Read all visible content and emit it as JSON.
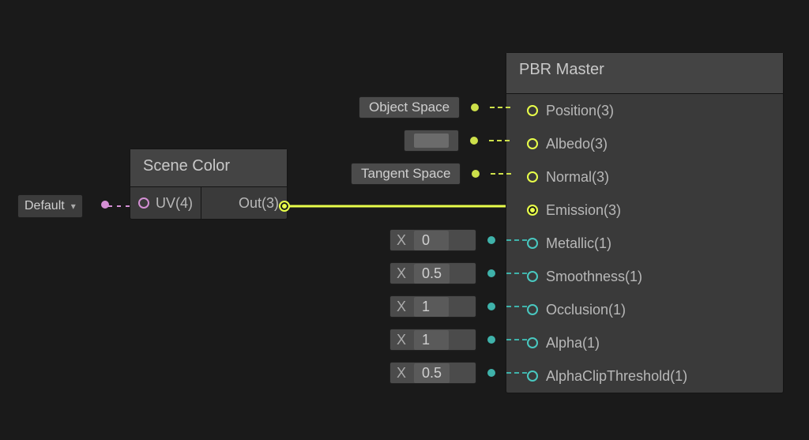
{
  "default_dropdown": {
    "label": "Default"
  },
  "scene_color": {
    "title": "Scene Color",
    "in_label": "UV(4)",
    "out_label": "Out(3)"
  },
  "pbr": {
    "title": "PBR Master",
    "ports": {
      "position": {
        "label": "Position(3)"
      },
      "albedo": {
        "label": "Albedo(3)"
      },
      "normal": {
        "label": "Normal(3)"
      },
      "emission": {
        "label": "Emission(3)"
      },
      "metallic": {
        "label": "Metallic(1)"
      },
      "smoothness": {
        "label": "Smoothness(1)"
      },
      "occlusion": {
        "label": "Occlusion(1)"
      },
      "alpha": {
        "label": "Alpha(1)"
      },
      "alphaclip": {
        "label": "AlphaClipThreshold(1)"
      }
    },
    "inline": {
      "object_space": "Object Space",
      "tangent_space": "Tangent Space",
      "metallic": {
        "x": "X",
        "value": "0"
      },
      "smoothness": {
        "x": "X",
        "value": "0.5"
      },
      "occlusion": {
        "x": "X",
        "value": "1"
      },
      "alpha": {
        "x": "X",
        "value": "1"
      },
      "alphaclip": {
        "x": "X",
        "value": "0.5"
      }
    }
  },
  "colors": {
    "wire_yellow": "#e8ff4a",
    "wire_pink": "#d48fd4"
  }
}
